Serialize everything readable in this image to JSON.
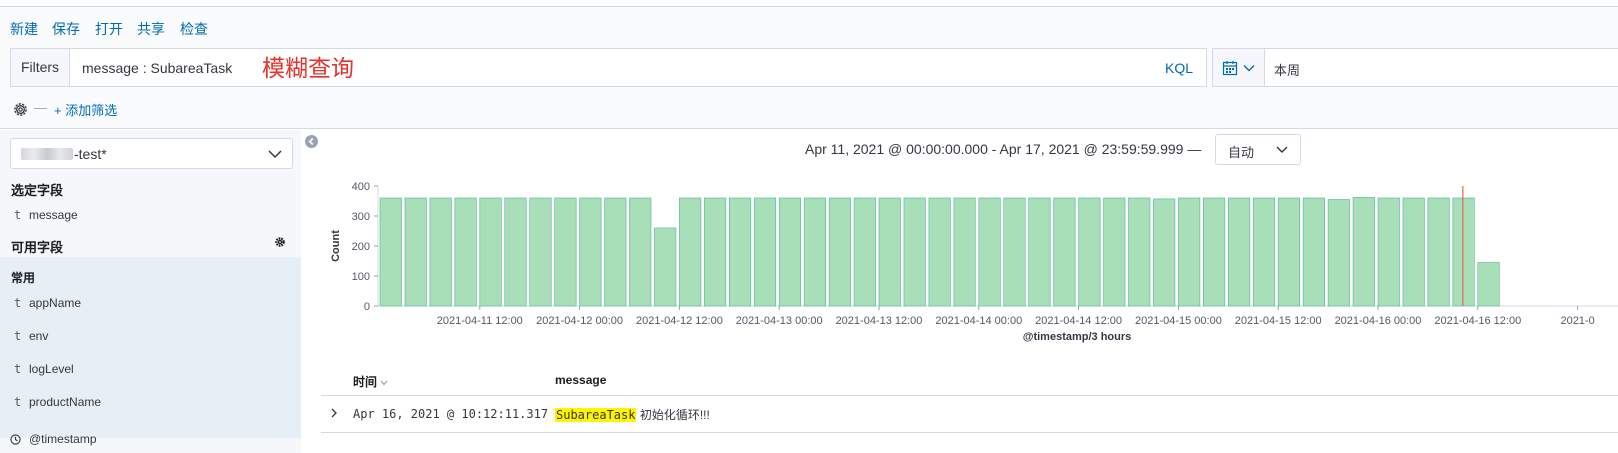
{
  "toolbar": {
    "new": "新建",
    "save": "保存",
    "open": "打开",
    "share": "共享",
    "inspect": "检查"
  },
  "query": {
    "filters_label": "Filters",
    "value": "message : SubareaTask",
    "annotation": "模糊查询",
    "language": "KQL"
  },
  "date_picker": {
    "icon": "calendar-icon",
    "value": "本周"
  },
  "filter_bar": {
    "separator": "—",
    "add_filter": "+ 添加筛选"
  },
  "sidebar": {
    "index_pattern_suffix": "-test*",
    "selected_heading": "选定字段",
    "selected_fields": [
      {
        "type": "t",
        "name": "message"
      }
    ],
    "available_heading": "可用字段",
    "popular_label": "常用",
    "popular_fields": [
      {
        "type": "t",
        "name": "appName"
      },
      {
        "type": "t",
        "name": "env"
      },
      {
        "type": "t",
        "name": "logLevel"
      },
      {
        "type": "t",
        "name": "productName"
      }
    ],
    "other_fields": [
      {
        "type": "clock",
        "name": "@timestamp"
      }
    ]
  },
  "main": {
    "time_range": "Apr 11, 2021 @ 00:00:00.000 - Apr 17, 2021 @ 23:59:59.999 —",
    "interval": "自动"
  },
  "chart_data": {
    "type": "bar",
    "title": "",
    "xlabel": "@timestamp/3 hours",
    "ylabel": "Count",
    "ylim": [
      0,
      400
    ],
    "yticks": [
      0,
      100,
      200,
      300,
      400
    ],
    "x_tick_labels": [
      "2021-04-11 12:00",
      "2021-04-12 00:00",
      "2021-04-12 12:00",
      "2021-04-13 00:00",
      "2021-04-13 12:00",
      "2021-04-14 00:00",
      "2021-04-14 12:00",
      "2021-04-15 00:00",
      "2021-04-15 12:00",
      "2021-04-16 00:00",
      "2021-04-16 12:00",
      "2021-0"
    ],
    "categories": [
      "2021-04-11 00:00",
      "2021-04-11 03:00",
      "2021-04-11 06:00",
      "2021-04-11 09:00",
      "2021-04-11 12:00",
      "2021-04-11 15:00",
      "2021-04-11 18:00",
      "2021-04-11 21:00",
      "2021-04-12 00:00",
      "2021-04-12 03:00",
      "2021-04-12 06:00",
      "2021-04-12 09:00",
      "2021-04-12 12:00",
      "2021-04-12 15:00",
      "2021-04-12 18:00",
      "2021-04-12 21:00",
      "2021-04-13 00:00",
      "2021-04-13 03:00",
      "2021-04-13 06:00",
      "2021-04-13 09:00",
      "2021-04-13 12:00",
      "2021-04-13 15:00",
      "2021-04-13 18:00",
      "2021-04-13 21:00",
      "2021-04-14 00:00",
      "2021-04-14 03:00",
      "2021-04-14 06:00",
      "2021-04-14 09:00",
      "2021-04-14 12:00",
      "2021-04-14 15:00",
      "2021-04-14 18:00",
      "2021-04-14 21:00",
      "2021-04-15 00:00",
      "2021-04-15 03:00",
      "2021-04-15 06:00",
      "2021-04-15 09:00",
      "2021-04-15 12:00",
      "2021-04-15 15:00",
      "2021-04-15 18:00",
      "2021-04-15 21:00",
      "2021-04-16 00:00",
      "2021-04-16 03:00",
      "2021-04-16 06:00",
      "2021-04-16 09:00"
    ],
    "values": [
      360,
      360,
      360,
      360,
      360,
      360,
      360,
      360,
      360,
      360,
      360,
      260,
      360,
      360,
      360,
      360,
      360,
      360,
      360,
      360,
      360,
      360,
      360,
      360,
      360,
      360,
      360,
      360,
      360,
      360,
      360,
      357,
      360,
      360,
      360,
      360,
      360,
      360,
      355,
      362,
      360,
      360,
      360,
      360,
      145
    ],
    "current_time_marker": "2021-04-16 10:12",
    "bar_color": "#a8dfb8",
    "bar_stroke": "#54b399",
    "marker_color": "#e7664c",
    "grid": false
  },
  "table": {
    "col_time": "时间",
    "col_message": "message",
    "rows": [
      {
        "time": "Apr 16, 2021 @ 10:12:11.317",
        "highlight": "SubareaTask",
        "rest": " 初始化循环!!!"
      }
    ]
  }
}
